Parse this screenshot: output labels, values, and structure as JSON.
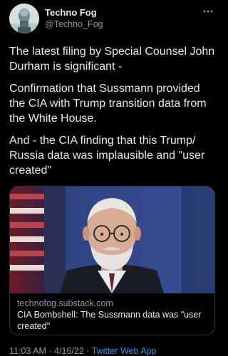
{
  "tweet": {
    "author": {
      "display_name": "Techno Fog",
      "handle": "@Techno_Fog"
    },
    "more_icon": "ellipsis-icon",
    "paragraphs": [
      "The latest filing by Special Counsel John Durham is significant -",
      "Confirmation that Sussmann provided the CIA with Trump transition data from the White House.",
      "And - the CIA finding that this Trump/ Russia data was implausible and \"user created\""
    ],
    "link_card": {
      "domain": "technofog.substack.com",
      "title": "CIA Bombshell: The Sussmann data was \"user created\""
    },
    "footer": {
      "time": "11:03 AM",
      "separator1": "·",
      "date": "4/16/22",
      "separator2": "·",
      "source": "Twitter Web App"
    }
  },
  "colors": {
    "background": "#000000",
    "text_primary": "#e7e9ea",
    "text_secondary": "#8b98a5",
    "link": "#1d9bf0",
    "border": "#2f3336"
  }
}
